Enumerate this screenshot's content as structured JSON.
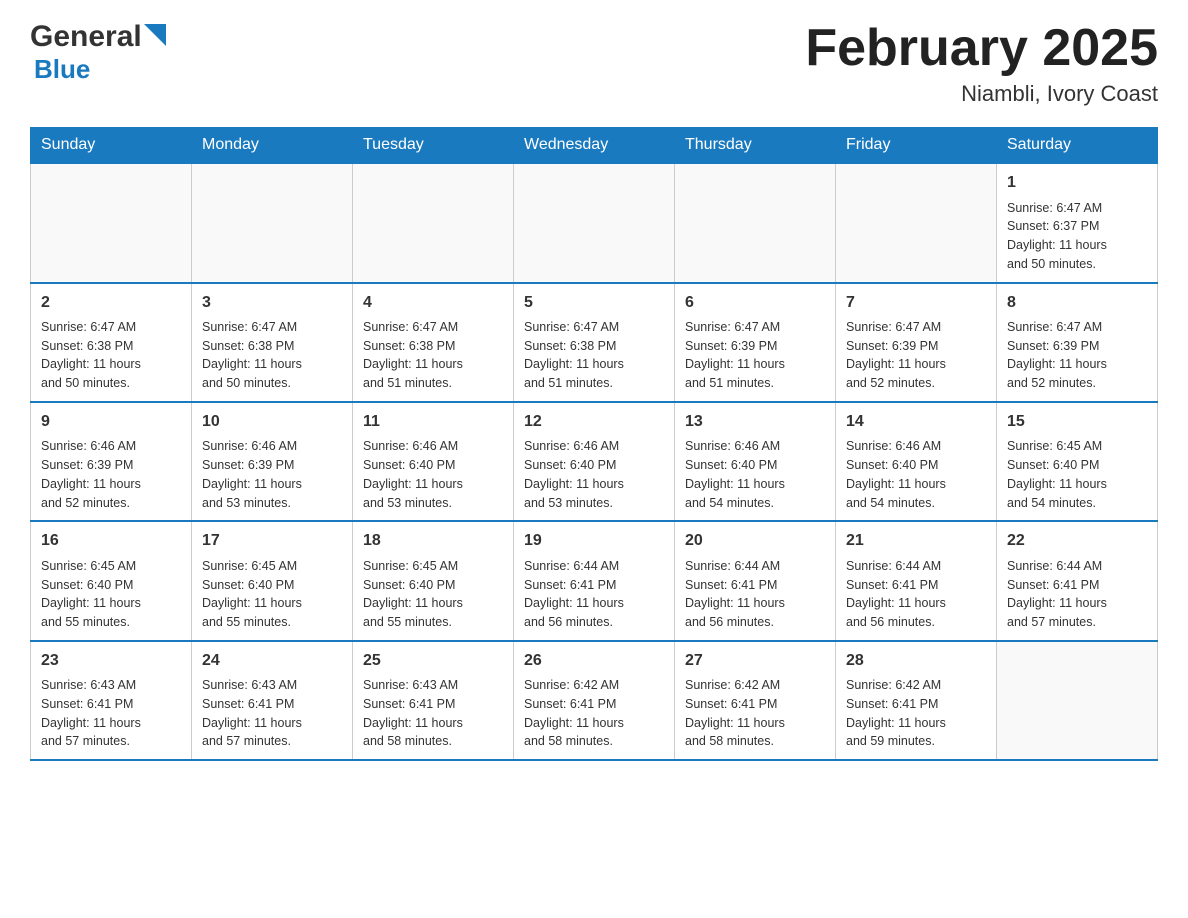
{
  "header": {
    "logo_general": "General",
    "logo_blue": "Blue",
    "month_title": "February 2025",
    "location": "Niambli, Ivory Coast"
  },
  "weekdays": [
    "Sunday",
    "Monday",
    "Tuesday",
    "Wednesday",
    "Thursday",
    "Friday",
    "Saturday"
  ],
  "weeks": [
    [
      {
        "day": "",
        "info": ""
      },
      {
        "day": "",
        "info": ""
      },
      {
        "day": "",
        "info": ""
      },
      {
        "day": "",
        "info": ""
      },
      {
        "day": "",
        "info": ""
      },
      {
        "day": "",
        "info": ""
      },
      {
        "day": "1",
        "info": "Sunrise: 6:47 AM\nSunset: 6:37 PM\nDaylight: 11 hours\nand 50 minutes."
      }
    ],
    [
      {
        "day": "2",
        "info": "Sunrise: 6:47 AM\nSunset: 6:38 PM\nDaylight: 11 hours\nand 50 minutes."
      },
      {
        "day": "3",
        "info": "Sunrise: 6:47 AM\nSunset: 6:38 PM\nDaylight: 11 hours\nand 50 minutes."
      },
      {
        "day": "4",
        "info": "Sunrise: 6:47 AM\nSunset: 6:38 PM\nDaylight: 11 hours\nand 51 minutes."
      },
      {
        "day": "5",
        "info": "Sunrise: 6:47 AM\nSunset: 6:38 PM\nDaylight: 11 hours\nand 51 minutes."
      },
      {
        "day": "6",
        "info": "Sunrise: 6:47 AM\nSunset: 6:39 PM\nDaylight: 11 hours\nand 51 minutes."
      },
      {
        "day": "7",
        "info": "Sunrise: 6:47 AM\nSunset: 6:39 PM\nDaylight: 11 hours\nand 52 minutes."
      },
      {
        "day": "8",
        "info": "Sunrise: 6:47 AM\nSunset: 6:39 PM\nDaylight: 11 hours\nand 52 minutes."
      }
    ],
    [
      {
        "day": "9",
        "info": "Sunrise: 6:46 AM\nSunset: 6:39 PM\nDaylight: 11 hours\nand 52 minutes."
      },
      {
        "day": "10",
        "info": "Sunrise: 6:46 AM\nSunset: 6:39 PM\nDaylight: 11 hours\nand 53 minutes."
      },
      {
        "day": "11",
        "info": "Sunrise: 6:46 AM\nSunset: 6:40 PM\nDaylight: 11 hours\nand 53 minutes."
      },
      {
        "day": "12",
        "info": "Sunrise: 6:46 AM\nSunset: 6:40 PM\nDaylight: 11 hours\nand 53 minutes."
      },
      {
        "day": "13",
        "info": "Sunrise: 6:46 AM\nSunset: 6:40 PM\nDaylight: 11 hours\nand 54 minutes."
      },
      {
        "day": "14",
        "info": "Sunrise: 6:46 AM\nSunset: 6:40 PM\nDaylight: 11 hours\nand 54 minutes."
      },
      {
        "day": "15",
        "info": "Sunrise: 6:45 AM\nSunset: 6:40 PM\nDaylight: 11 hours\nand 54 minutes."
      }
    ],
    [
      {
        "day": "16",
        "info": "Sunrise: 6:45 AM\nSunset: 6:40 PM\nDaylight: 11 hours\nand 55 minutes."
      },
      {
        "day": "17",
        "info": "Sunrise: 6:45 AM\nSunset: 6:40 PM\nDaylight: 11 hours\nand 55 minutes."
      },
      {
        "day": "18",
        "info": "Sunrise: 6:45 AM\nSunset: 6:40 PM\nDaylight: 11 hours\nand 55 minutes."
      },
      {
        "day": "19",
        "info": "Sunrise: 6:44 AM\nSunset: 6:41 PM\nDaylight: 11 hours\nand 56 minutes."
      },
      {
        "day": "20",
        "info": "Sunrise: 6:44 AM\nSunset: 6:41 PM\nDaylight: 11 hours\nand 56 minutes."
      },
      {
        "day": "21",
        "info": "Sunrise: 6:44 AM\nSunset: 6:41 PM\nDaylight: 11 hours\nand 56 minutes."
      },
      {
        "day": "22",
        "info": "Sunrise: 6:44 AM\nSunset: 6:41 PM\nDaylight: 11 hours\nand 57 minutes."
      }
    ],
    [
      {
        "day": "23",
        "info": "Sunrise: 6:43 AM\nSunset: 6:41 PM\nDaylight: 11 hours\nand 57 minutes."
      },
      {
        "day": "24",
        "info": "Sunrise: 6:43 AM\nSunset: 6:41 PM\nDaylight: 11 hours\nand 57 minutes."
      },
      {
        "day": "25",
        "info": "Sunrise: 6:43 AM\nSunset: 6:41 PM\nDaylight: 11 hours\nand 58 minutes."
      },
      {
        "day": "26",
        "info": "Sunrise: 6:42 AM\nSunset: 6:41 PM\nDaylight: 11 hours\nand 58 minutes."
      },
      {
        "day": "27",
        "info": "Sunrise: 6:42 AM\nSunset: 6:41 PM\nDaylight: 11 hours\nand 58 minutes."
      },
      {
        "day": "28",
        "info": "Sunrise: 6:42 AM\nSunset: 6:41 PM\nDaylight: 11 hours\nand 59 minutes."
      },
      {
        "day": "",
        "info": ""
      }
    ]
  ]
}
